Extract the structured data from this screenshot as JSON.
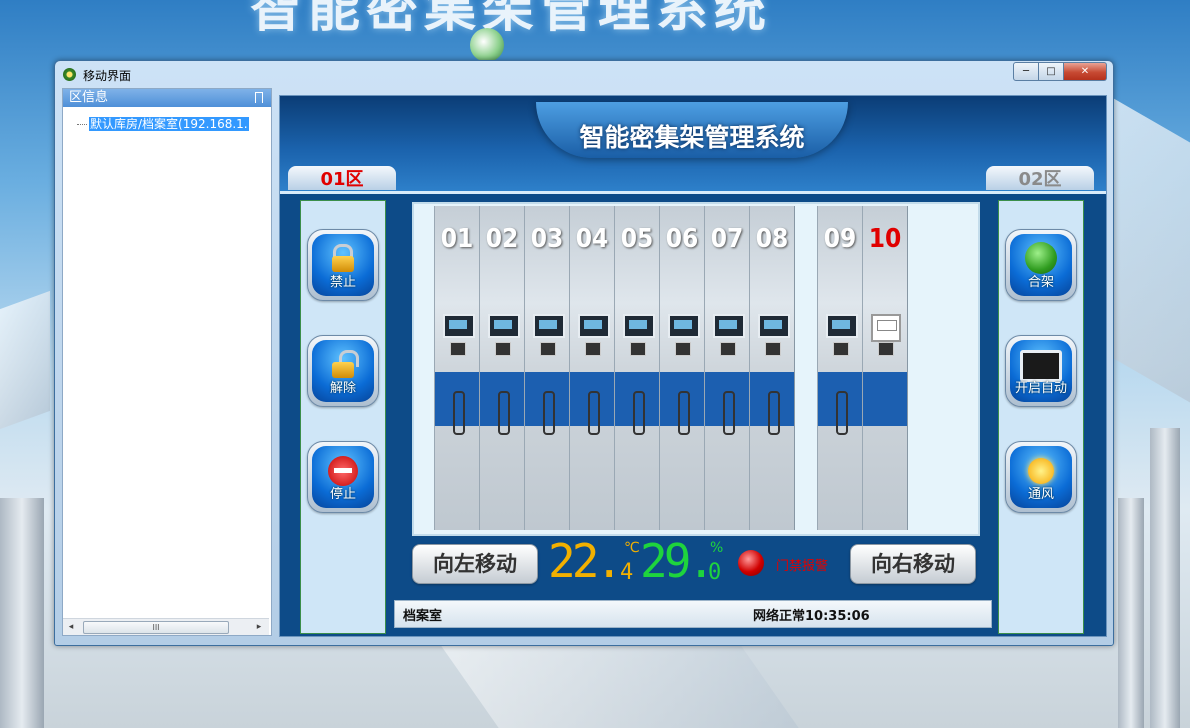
{
  "background": {
    "banner_title": "智能密集架管理系统"
  },
  "window": {
    "title": "移动界面",
    "controls": {
      "minimize": "─",
      "maximize": "□",
      "close": "✕"
    }
  },
  "sidebar": {
    "header": "区信息",
    "tree_item": "默认库房/档案室(192.168.1.",
    "scroll_thumb": "III"
  },
  "header": {
    "title": "智能密集架管理系统",
    "zone_left": "01区",
    "zone_right": "02区"
  },
  "left_buttons": [
    {
      "label": "禁止",
      "icon": "lock-closed-icon"
    },
    {
      "label": "解除",
      "icon": "lock-open-icon"
    },
    {
      "label": "停止",
      "icon": "stop-icon"
    }
  ],
  "right_buttons": [
    {
      "label": "合架",
      "icon": "globe-refresh-icon"
    },
    {
      "label": "开启自动",
      "icon": "monitor-icon"
    },
    {
      "label": "通风",
      "icon": "sun-icon"
    }
  ],
  "shelves": [
    "01",
    "02",
    "03",
    "04",
    "05",
    "06",
    "07",
    "08",
    "09",
    "10"
  ],
  "controls": {
    "move_left": "向左移动",
    "move_right": "向右移动",
    "temperature": "22.",
    "temperature_decimal": "4",
    "temperature_unit": "℃",
    "humidity": "29.",
    "humidity_decimal": "0",
    "humidity_unit": "%",
    "alarm_text": "门禁报警"
  },
  "status": {
    "location": "档案室",
    "network": "网络正常10:35:06"
  },
  "colors": {
    "accent_red": "#e00000",
    "temp_color": "#f2b000",
    "humidity_color": "#1ed43d",
    "panel_blue": "#0d4b88"
  }
}
